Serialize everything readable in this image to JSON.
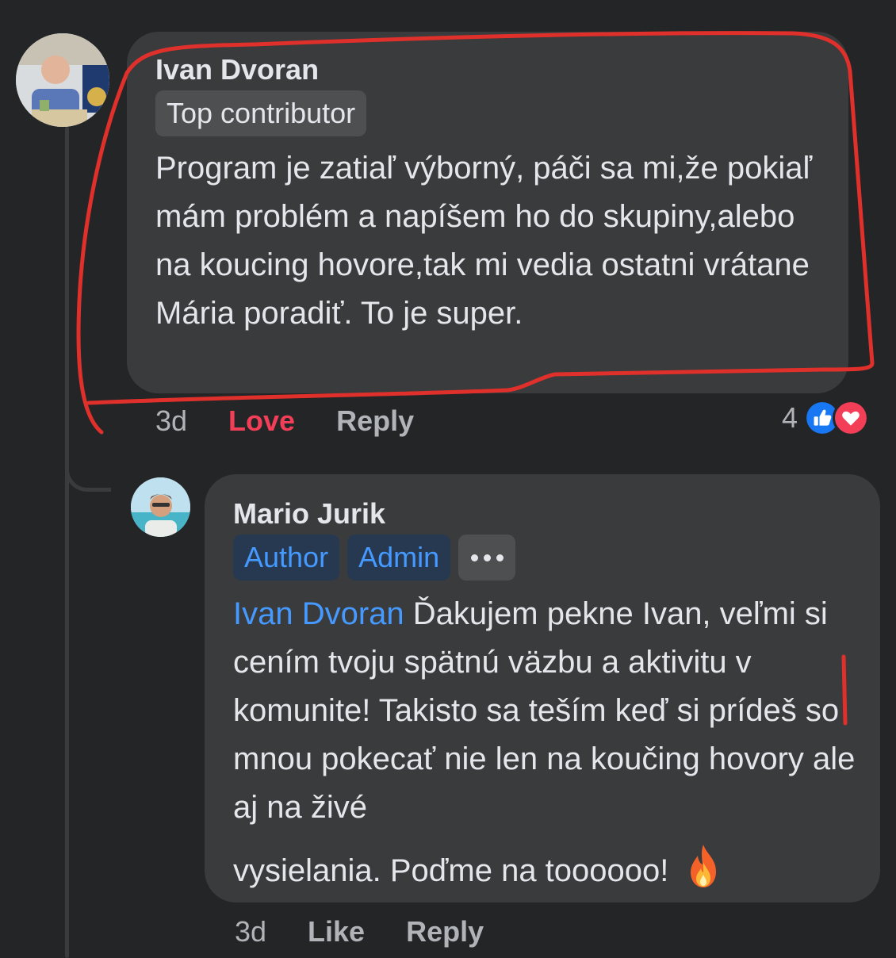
{
  "comment": {
    "author": "Ivan Dvoran",
    "badge": "Top contributor",
    "text": "Program je zatiaľ výborný, páči sa mi,že pokiaľ mám problém a napíšem ho do skupiny,alebo na koucing hovore,tak mi vedia ostatni vrátane Mária poradiť. To je super.",
    "time": "3d",
    "reaction_label": "Love",
    "reply_label": "Reply",
    "reaction_count": "4",
    "reaction_icons": [
      "like-icon",
      "love-icon"
    ]
  },
  "reply": {
    "author": "Mario Jurik",
    "badges": [
      "Author",
      "Admin"
    ],
    "more_icon": "more-icon",
    "mention": "Ivan Dvoran",
    "text_main": " Ďakujem pekne Ivan, veľmi si cením tvoju spätnú väzbu a aktivitu v komunite! Takisto sa teším keď si prídeš so mnou pokecať nie len na koučing hovory ale aj na živé",
    "text_last": "vysielania. Poďme na toooooo!",
    "emoji": "fire-icon",
    "time": "3d",
    "like_label": "Like",
    "reply_label": "Reply"
  },
  "colors": {
    "background": "#242526",
    "bubble": "#3a3b3c",
    "mention": "#4599ff",
    "love": "#f33e58",
    "like": "#1877f2",
    "annotation": "#e0302b"
  }
}
